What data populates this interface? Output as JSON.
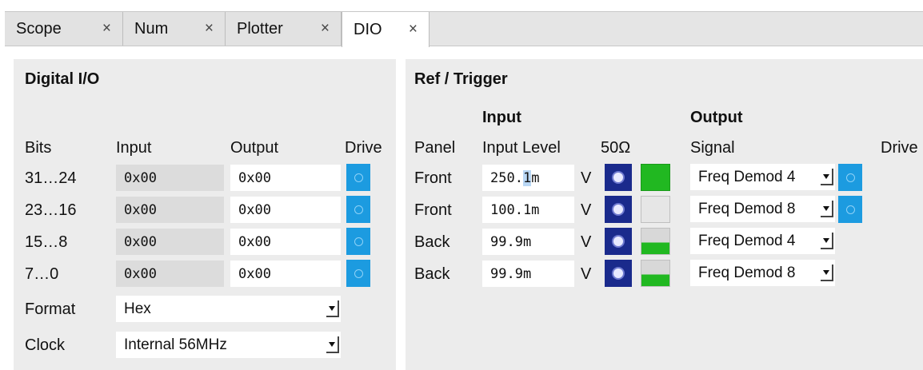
{
  "tabs": [
    {
      "label": "Scope"
    },
    {
      "label": "Num"
    },
    {
      "label": "Plotter"
    },
    {
      "label": "DIO",
      "active": true
    }
  ],
  "close_glyph": "×",
  "digital_io": {
    "title": "Digital I/O",
    "headers": {
      "bits": "Bits",
      "input": "Input",
      "output": "Output",
      "drive": "Drive"
    },
    "rows": [
      {
        "bits": "31…24",
        "input": "0x00",
        "output": "0x00"
      },
      {
        "bits": "23…16",
        "input": "0x00",
        "output": "0x00"
      },
      {
        "bits": "15…8",
        "input": "0x00",
        "output": "0x00"
      },
      {
        "bits": "7…0",
        "input": "0x00",
        "output": "0x00"
      }
    ],
    "format": {
      "label": "Format",
      "value": "Hex"
    },
    "clock": {
      "label": "Clock",
      "value": "Internal 56MHz"
    }
  },
  "ref_trigger": {
    "title": "Ref / Trigger",
    "group_input": "Input",
    "group_output": "Output",
    "headers": {
      "panel": "Panel",
      "input_level": "Input Level",
      "ohm": "50Ω",
      "signal": "Signal",
      "drive": "Drive"
    },
    "unit": "V",
    "rows": [
      {
        "panel": "Front",
        "level_a": "250.",
        "level_cursor": "1",
        "level_b": "m",
        "signal": "Freq Demod 4",
        "led": "on",
        "drive": true
      },
      {
        "panel": "Front",
        "level_a": "100.1m",
        "level_cursor": "",
        "level_b": "",
        "signal": "Freq Demod 8",
        "led": "off",
        "drive": true
      },
      {
        "panel": "Back",
        "level_a": "99.9m",
        "level_cursor": "",
        "level_b": "",
        "signal": "Freq Demod 4",
        "led": "half",
        "drive": false
      },
      {
        "panel": "Back",
        "level_a": "99.9m",
        "level_cursor": "",
        "level_b": "",
        "signal": "Freq Demod 8",
        "led": "half",
        "drive": false
      }
    ]
  },
  "colors": {
    "drive_button": "#1c9be0",
    "ohm_button": "#1a2a8c",
    "led_green": "#21b821"
  },
  "icons": {
    "dropdown": "dropdown-arrow-icon",
    "drive": "drive-toggle-icon"
  }
}
